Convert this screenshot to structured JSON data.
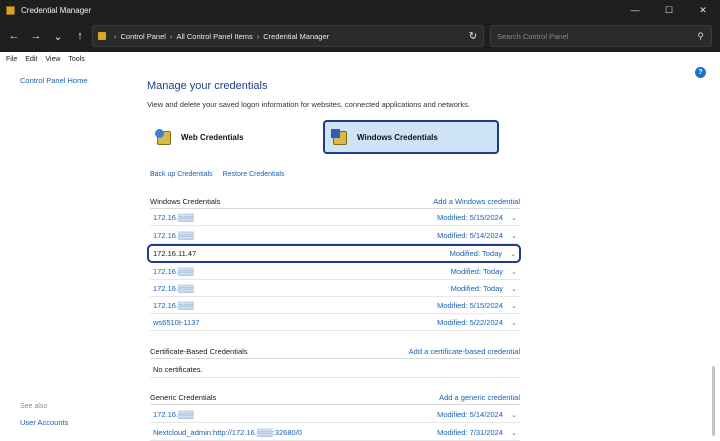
{
  "window": {
    "title": "Credential Manager",
    "controls": [
      "—",
      "☐",
      "✕"
    ]
  },
  "address": {
    "breadcrumbs": [
      "Control Panel",
      "All Control Panel Items",
      "Credential Manager"
    ],
    "search_placeholder": "Search Control Panel"
  },
  "menu": [
    "File",
    "Edit",
    "View",
    "Tools"
  ],
  "sidebar": {
    "home": "Control Panel Home",
    "see_also": "See also",
    "user_accounts": "User Accounts"
  },
  "main": {
    "heading": "Manage your credentials",
    "subtitle": "View and delete your saved logon information for websites, connected applications and networks.",
    "web_tile": "Web Credentials",
    "windows_tile": "Windows Credentials",
    "backup": "Back up Credentials",
    "restore": "Restore Credentials"
  },
  "windows_credentials": {
    "title": "Windows Credentials",
    "add_link": "Add a Windows credential",
    "items": [
      {
        "name": "172.16.▒▒▒",
        "modified": "Modified:  5/15/2024"
      },
      {
        "name": "172.16.▒▒▒",
        "modified": "Modified:  5/14/2024"
      },
      {
        "name": "172.16.11.47",
        "modified": "Modified:  Today"
      },
      {
        "name": "172.16.▒▒▒",
        "modified": "Modified:  Today"
      },
      {
        "name": "172.16.▒▒▒",
        "modified": "Modified:  Today"
      },
      {
        "name": "172.16.▒▒▒",
        "modified": "Modified:  5/15/2024"
      },
      {
        "name": "ws6510t-1137",
        "modified": "Modified:  5/22/2024"
      }
    ]
  },
  "certificate_credentials": {
    "title": "Certificate-Based Credentials",
    "add_link": "Add a certificate-based credential",
    "empty_text": "No certificates."
  },
  "generic_credentials": {
    "title": "Generic Credentials",
    "add_link": "Add a generic credential",
    "items": [
      {
        "name": "172.16.▒▒▒",
        "modified": "Modified:  5/14/2024"
      },
      {
        "name": "Nextcloud_admin:http://172.16.▒▒▒:32680/0",
        "modified": "Modified:  7/31/2024"
      }
    ]
  },
  "colors": {
    "titlebar": "#1f1f1f",
    "link": "#1a5fb4",
    "heading": "#1e3f8a",
    "selection_border": "#1e3a8a",
    "selected_tile_bg": "#cfe3f7"
  }
}
